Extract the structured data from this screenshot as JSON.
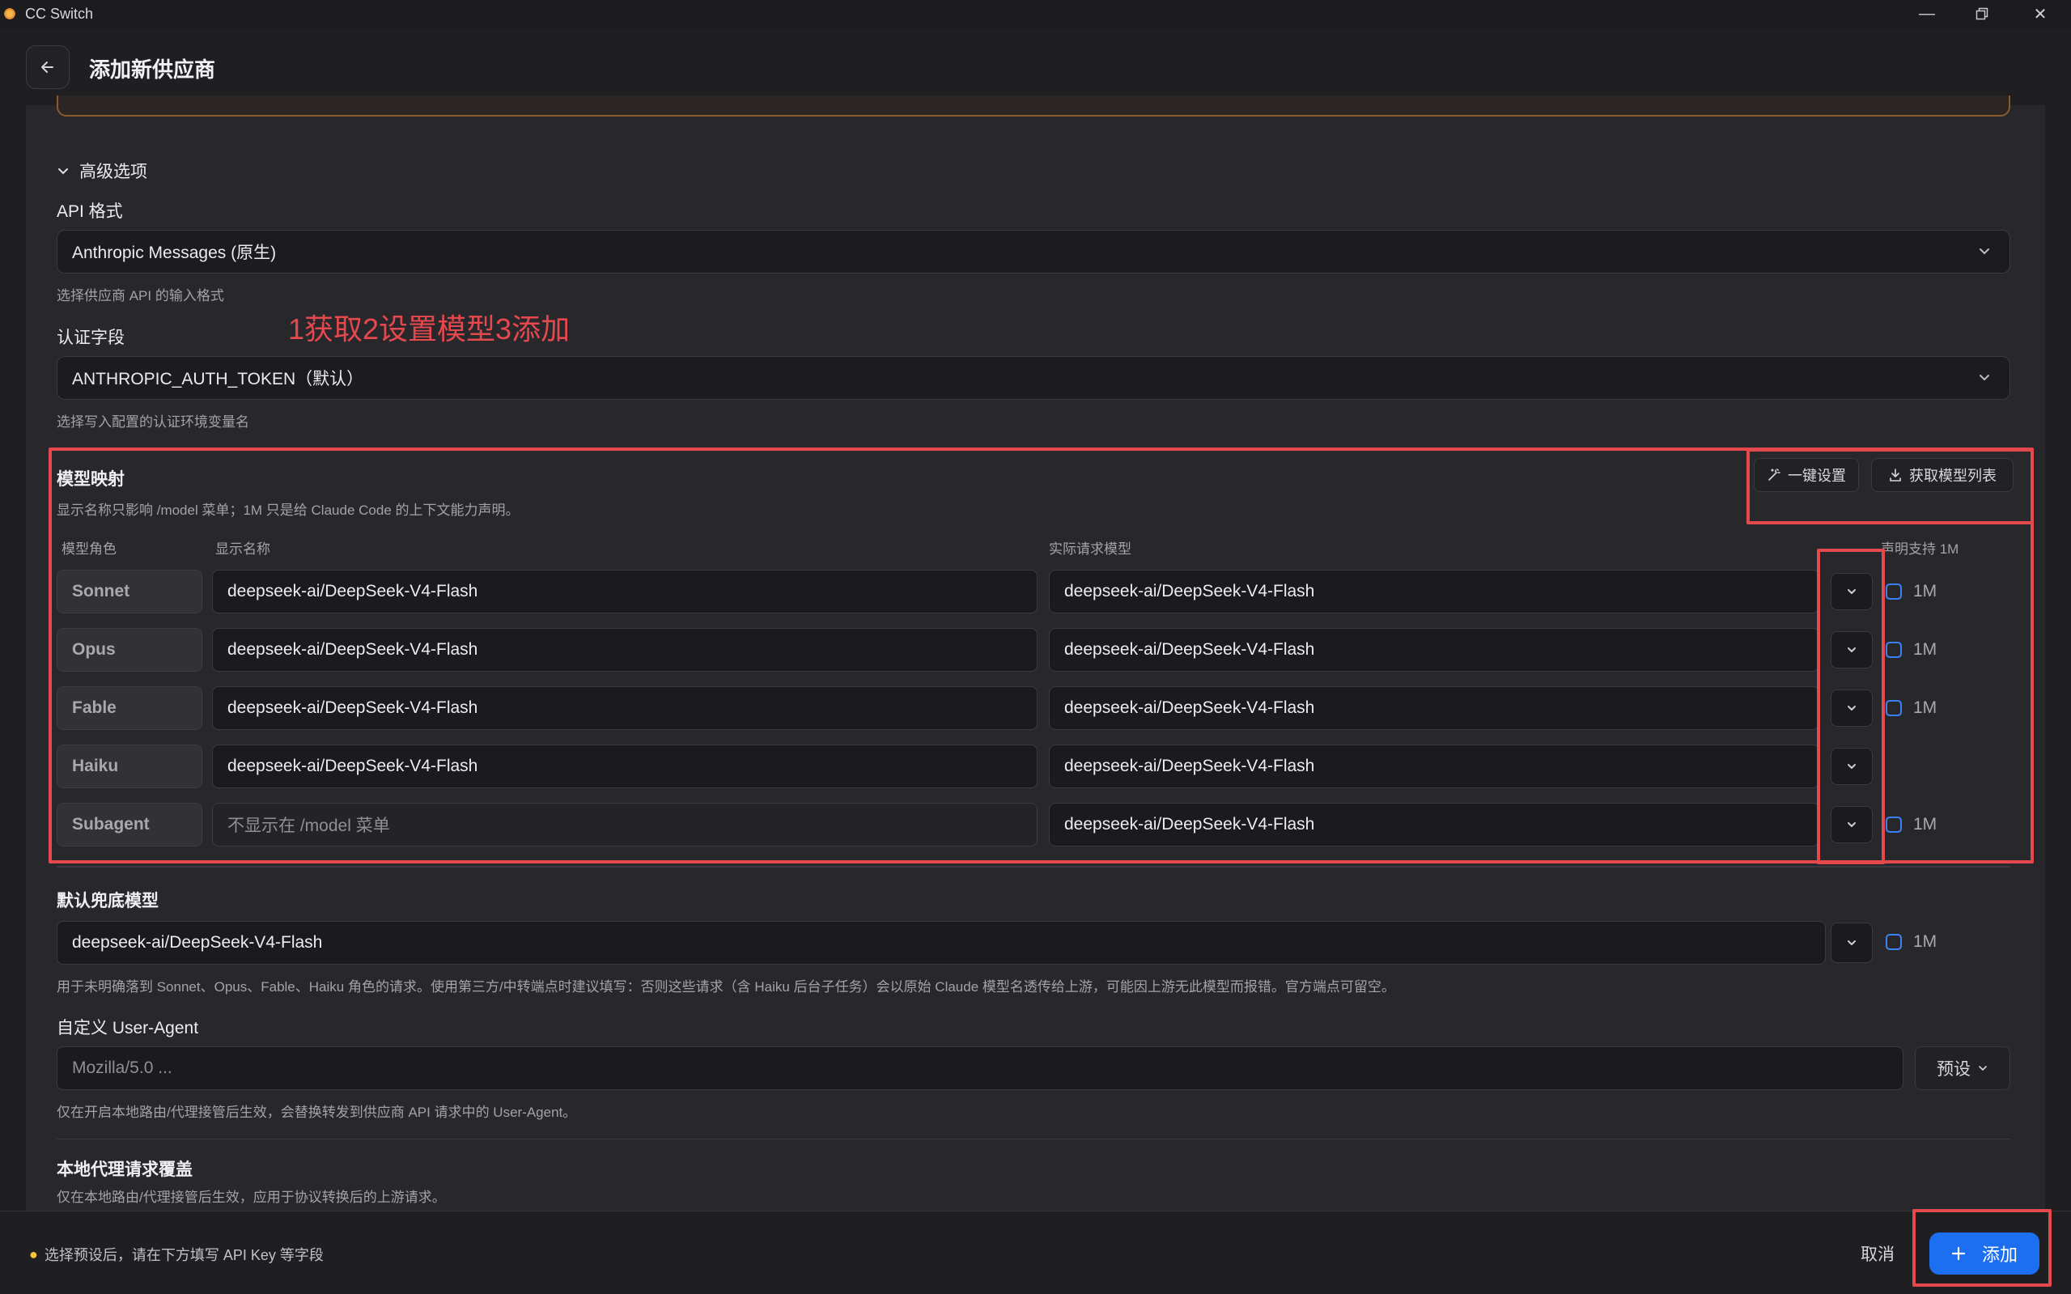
{
  "window": {
    "title": "CC Switch",
    "controls": [
      "minimize-icon",
      "restore-icon",
      "close-icon"
    ]
  },
  "header": {
    "back_icon": "arrow-left-icon",
    "title": "添加新供应商"
  },
  "advanced": {
    "toggle_label": "高级选项",
    "api_format": {
      "label": "API 格式",
      "value": "Anthropic Messages (原生)",
      "hint": "选择供应商 API 的输入格式"
    },
    "auth_field": {
      "label": "认证字段",
      "value": "ANTHROPIC_AUTH_TOKEN（默认）",
      "hint": "选择写入配置的认证环境变量名"
    }
  },
  "annotation": {
    "text": "1获取2设置模型3添加",
    "color": "#e5484d"
  },
  "model_mapping": {
    "title": "模型映射",
    "description": "显示名称只影响 /model 菜单；1M 只是给 Claude Code 的上下文能力声明。",
    "one_click_label": "一键设置",
    "fetch_list_label": "获取模型列表",
    "columns": {
      "role": "模型角色",
      "display": "显示名称",
      "actual": "实际请求模型",
      "declare": "声明支持 1M"
    },
    "rows": [
      {
        "role": "Sonnet",
        "display": "deepseek-ai/DeepSeek-V4-Flash",
        "actual": "deepseek-ai/DeepSeek-V4-Flash",
        "chk": "1M"
      },
      {
        "role": "Opus",
        "display": "deepseek-ai/DeepSeek-V4-Flash",
        "actual": "deepseek-ai/DeepSeek-V4-Flash",
        "chk": "1M"
      },
      {
        "role": "Fable",
        "display": "deepseek-ai/DeepSeek-V4-Flash",
        "actual": "deepseek-ai/DeepSeek-V4-Flash",
        "chk": "1M"
      },
      {
        "role": "Haiku",
        "display": "deepseek-ai/DeepSeek-V4-Flash",
        "actual": "deepseek-ai/DeepSeek-V4-Flash",
        "chk": ""
      },
      {
        "role": "Subagent",
        "display_placeholder": "不显示在 /model 菜单",
        "actual": "deepseek-ai/DeepSeek-V4-Flash",
        "chk": "1M"
      }
    ]
  },
  "fallback": {
    "label": "默认兜底模型",
    "value": "deepseek-ai/DeepSeek-V4-Flash",
    "chk": "1M",
    "hint": "用于未明确落到 Sonnet、Opus、Fable、Haiku 角色的请求。使用第三方/中转端点时建议填写：否则这些请求（含 Haiku 后台子任务）会以原始 Claude 模型名透传给上游，可能因上游无此模型而报错。官方端点可留空。"
  },
  "user_agent": {
    "label": "自定义 User-Agent",
    "placeholder": "Mozilla/5.0 ...",
    "preset_label": "预设",
    "hint": "仅在开启本地路由/代理接管后生效，会替换转发到供应商 API 请求中的 User-Agent。"
  },
  "proxy_override": {
    "label": "本地代理请求覆盖",
    "hint": "仅在本地路由/代理接管后生效，应用于协议转换后的上游请求。"
  },
  "footer": {
    "hint": "选择预设后，请在下方填写 API Key 等字段",
    "cancel_label": "取消",
    "add_label": "添加",
    "primary_color": "#1d6ff2"
  }
}
